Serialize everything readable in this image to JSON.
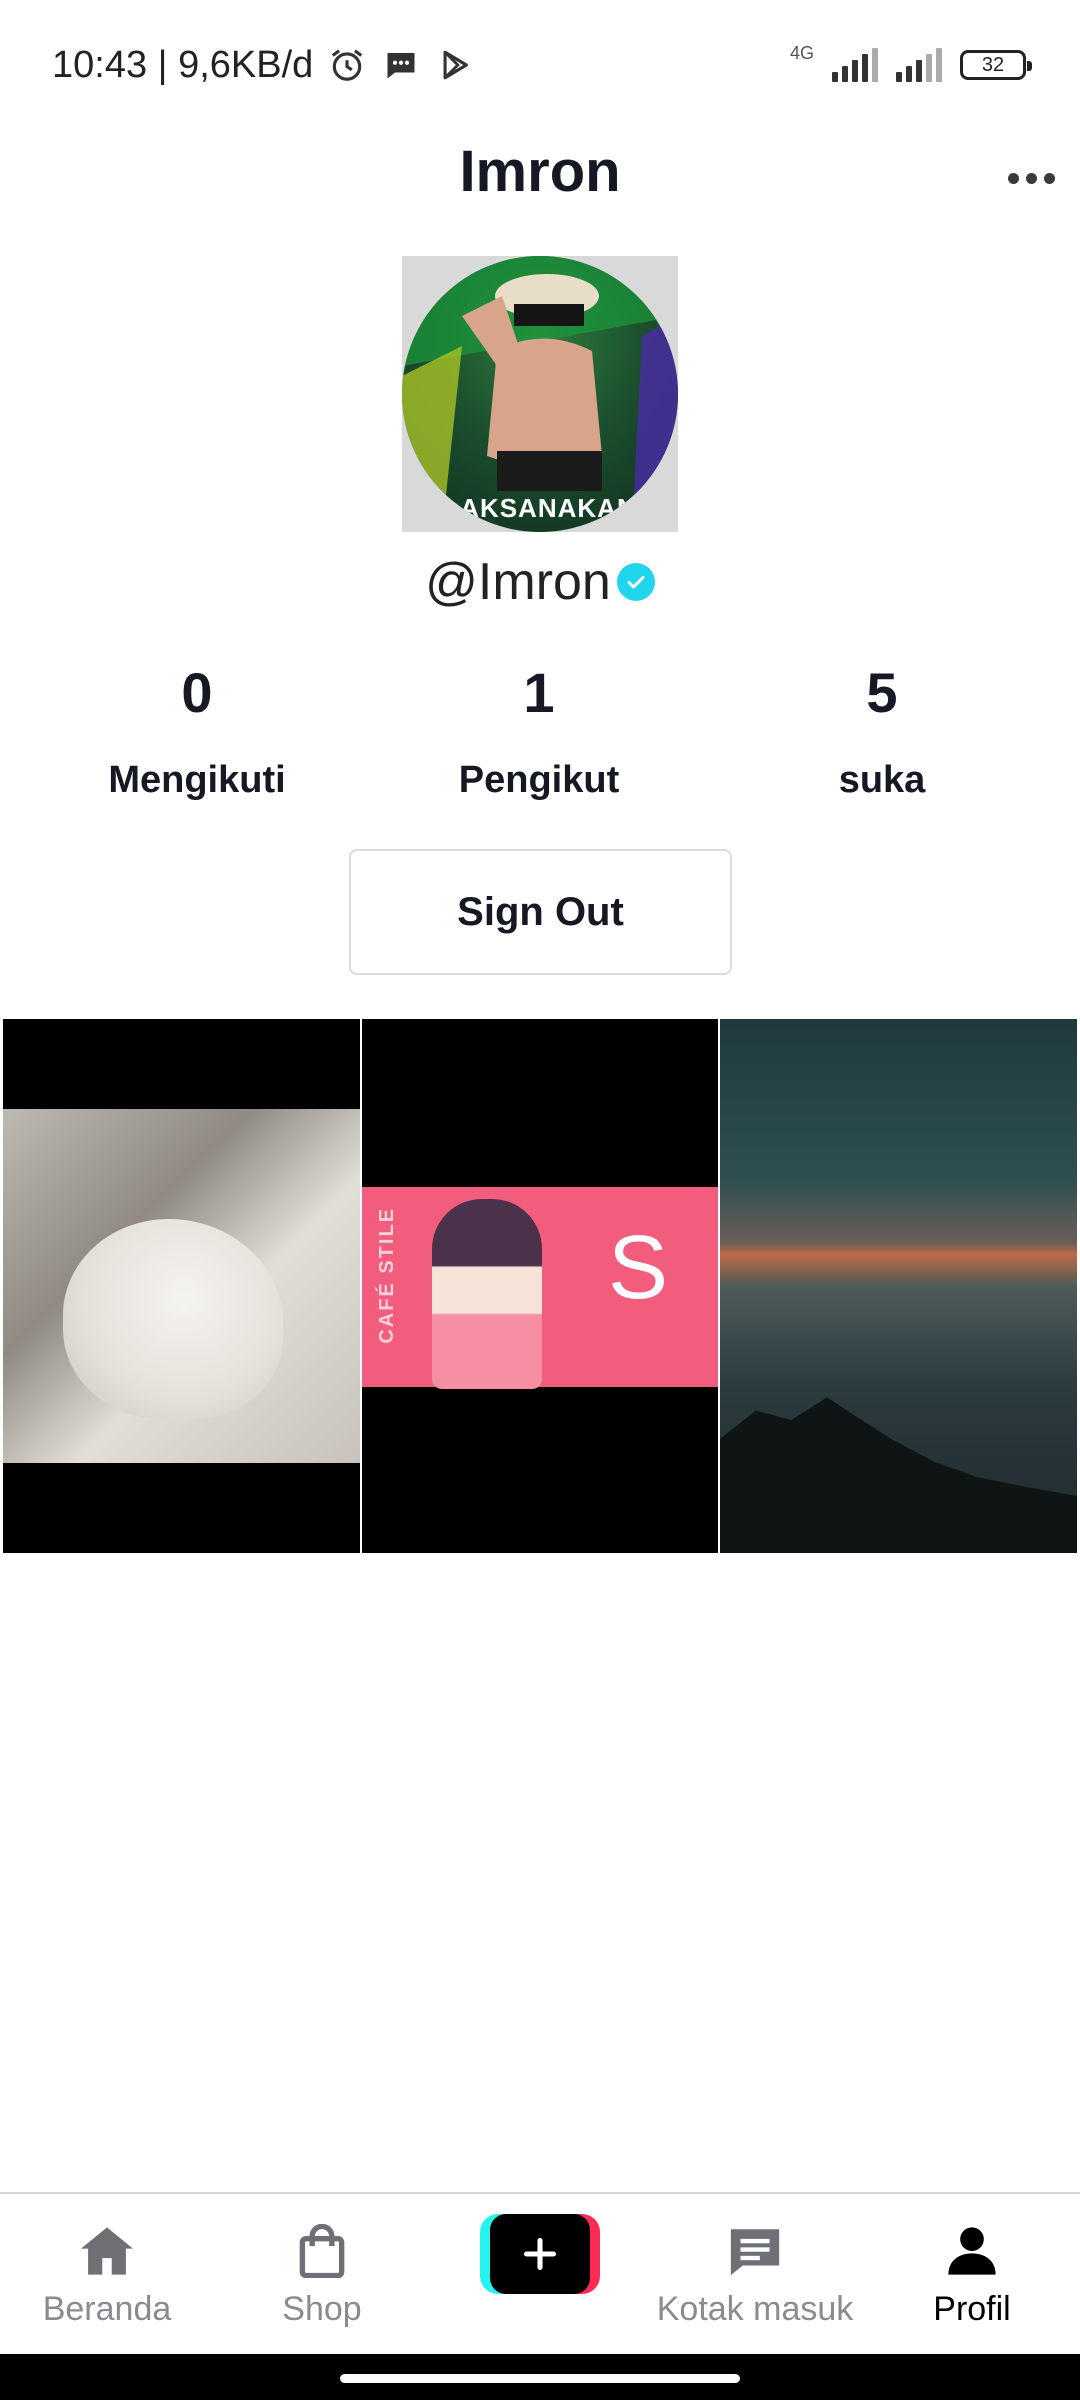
{
  "status_bar": {
    "time_and_speed": "10:43 | 9,6KB/d",
    "network": "4G",
    "battery": "32",
    "icons": [
      "alarm-icon",
      "message-icon",
      "play-store-icon"
    ]
  },
  "header": {
    "title": "Imron",
    "more_icon": "more-horizontal-icon"
  },
  "profile": {
    "avatar_caption": "LAKSANAKAN",
    "username": "@Imron",
    "verified": true,
    "stats": [
      {
        "value": "0",
        "label": "Mengikuti"
      },
      {
        "value": "1",
        "label": "Pengikut"
      },
      {
        "value": "5",
        "label": "suka"
      }
    ],
    "sign_out_label": "Sign Out"
  },
  "videos": [
    {
      "thumbnail": "white-cat"
    },
    {
      "thumbnail": "anime-cafe",
      "big_letter": "S",
      "side_text": "CAFÉ STILE"
    },
    {
      "thumbnail": "sea-sunset"
    }
  ],
  "bottom_nav": {
    "items": [
      {
        "label": "Beranda",
        "icon": "home-icon"
      },
      {
        "label": "Shop",
        "icon": "shopping-bag-icon"
      },
      {
        "label": "",
        "icon": "plus-icon"
      },
      {
        "label": "Kotak masuk",
        "icon": "inbox-icon"
      },
      {
        "label": "Profil",
        "icon": "person-icon"
      }
    ],
    "active": "Profil"
  },
  "colors": {
    "accent_cyan": "#25f4ee",
    "accent_pink": "#fe2c55",
    "verified": "#20d5ec",
    "text_primary": "#161823",
    "nav_inactive": "#8a8b91"
  }
}
